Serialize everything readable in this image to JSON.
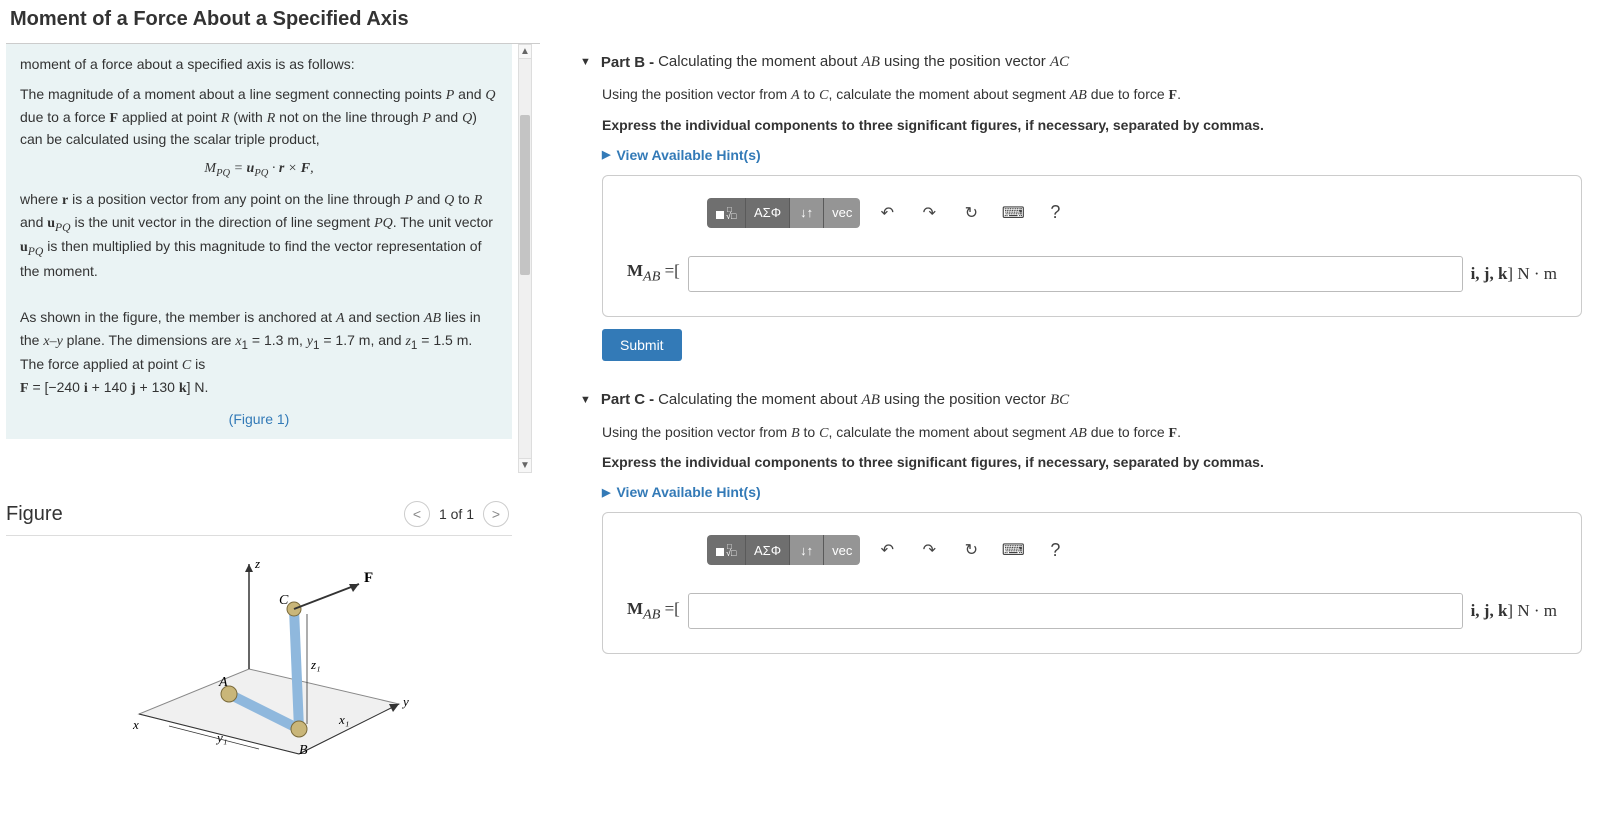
{
  "page_title": "Moment of a Force About a Specified Axis",
  "theory": {
    "line_top": "moment of a force about a specified axis is as follows:",
    "p1_a": "The magnitude of a moment about a line segment connecting points ",
    "p1_b": " and ",
    "p1_c": " due to a force ",
    "p1_d": " applied at point ",
    "p1_e": " (with ",
    "p1_f": " not on the line through ",
    "p1_g": " and ",
    "p1_h": ") can be calculated using the scalar triple product,",
    "eq1": "M_{PQ} = u_{PQ} · r × F,",
    "p2_a": "where ",
    "p2_b": " is a position vector from any point on the line through ",
    "p2_c": " and ",
    "p2_d": " to ",
    "p2_e": " and ",
    "p2_f": " is the unit vector in the direction of line segment ",
    "p2_g": ". The unit vector ",
    "p2_h": " is then multiplied by this magnitude to find the vector representation of the moment.",
    "p3_a": "As shown in the figure, the member is anchored at ",
    "p3_b": " and section ",
    "p3_c": " lies in the ",
    "p3_d": " plane. The dimensions are ",
    "p3_e": " = 1.3 m, ",
    "p3_f": " = 1.7 m, and ",
    "p3_g": " = 1.5 m. The force applied at point ",
    "p3_h": " is",
    "force_eq": "F = [−240 i + 140 j + 130 k] N.",
    "fig_link": "(Figure 1)"
  },
  "figure": {
    "title": "Figure",
    "pager": "1 of 1"
  },
  "partB": {
    "label": "Part B",
    "sep": "-",
    "title": "Calculating the moment about AB using the position vector AC",
    "p1_a": "Using the position vector from ",
    "p1_b": " to ",
    "p1_c": ", calculate the moment about segment ",
    "p1_d": " due to force ",
    "p1_e": ".",
    "instr": "Express the individual components to three significant figures, if necessary, separated by commas.",
    "hints": "View Available Hint(s)",
    "answer_prefix": "M_{AB} =[",
    "answer_suffix": "i, j, k] N · m",
    "submit": "Submit",
    "tool_greek": "ΑΣΦ",
    "tool_vec": "vec",
    "tool_help": "?"
  },
  "partC": {
    "label": "Part C",
    "sep": "-",
    "title": "Calculating the moment about AB using the position vector BC",
    "p1_a": "Using the position vector from ",
    "p1_b": " to ",
    "p1_c": ", calculate the moment about segment ",
    "p1_d": " due to force ",
    "p1_e": ".",
    "instr": "Express the individual components to three significant figures, if necessary, separated by commas.",
    "hints": "View Available Hint(s)",
    "answer_prefix": "M_{AB} =[",
    "answer_suffix": "i, j, k] N · m"
  }
}
